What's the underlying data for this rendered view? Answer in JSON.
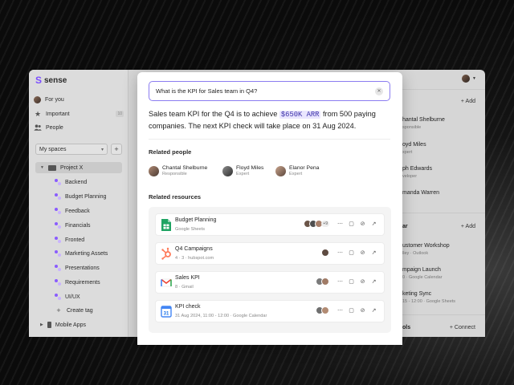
{
  "app": {
    "logo_text": "sense"
  },
  "sidebar": {
    "nav": [
      {
        "label": "For you",
        "icon": "avatar"
      },
      {
        "label": "Important",
        "icon": "star-icon",
        "count": "10"
      },
      {
        "label": "People",
        "icon": "people-icon"
      }
    ],
    "spaces_select": "My spaces",
    "project": "Project X",
    "tags": [
      "Backend",
      "Budget Planning",
      "Feedback",
      "Financials",
      "Fronted",
      "Marketing Assets",
      "Presentations",
      "Requirements",
      "UI/UX"
    ],
    "create_tag": "Create tag",
    "mobile_apps": "Mobile Apps"
  },
  "right_panel": {
    "add_label": "Add",
    "people": [
      {
        "name": "hantal Shelburne",
        "sub": "sponsible"
      },
      {
        "name": "oyd Miles",
        "sub": "xpert"
      },
      {
        "name": "ph Edwards",
        "sub": "veloper"
      },
      {
        "name": "manda Warren",
        "sub": ""
      }
    ],
    "section2_label": "ar",
    "events": [
      {
        "name": "ustomer Workshop",
        "sub": "lley · Outlook"
      },
      {
        "name": "mpaign Launch",
        "sub": "0 · Google Calendar"
      },
      {
        "name": "keting Sync",
        "sub": "15 - 12:00 · Google Sheets"
      }
    ],
    "section3_label": "ols",
    "connect_label": "Connect"
  },
  "search": {
    "query": "What is the KPI for Sales team in Q4?",
    "clear_icon": "close-icon"
  },
  "answer": {
    "part1": "Sales team KPI for the Q4 is to achieve ",
    "highlight": "$650K ARR",
    "part2": " from 500 paying companies. The next KPI check will take place on 31 Aug 2024."
  },
  "related_people": {
    "title": "Related people",
    "people": [
      {
        "name": "Chantal Shelburne",
        "role": "Responsible"
      },
      {
        "name": "Floyd Miles",
        "role": "Expert"
      },
      {
        "name": "Elanor Pena",
        "role": "Expert"
      }
    ]
  },
  "related_resources": {
    "title": "Related resources",
    "items": [
      {
        "title": "Budget Planning",
        "sub": "Google Sheets",
        "icon": "google-sheets-icon",
        "more": "+9"
      },
      {
        "title": "Q4 Campaigns",
        "sub": "4 · 3 · hubspot.com",
        "icon": "hubspot-icon"
      },
      {
        "title": "Sales KPI",
        "sub": "8 · Gmail",
        "icon": "gmail-icon"
      },
      {
        "title": "KPI check",
        "sub": "31 Aug 2024, 11:00 - 12:00 · Google Calendar",
        "icon": "google-calendar-icon",
        "cal_day": "31"
      }
    ]
  },
  "colors": {
    "accent": "#7b4dff",
    "highlight_bg": "#eae6ff",
    "highlight_fg": "#3a2fa8"
  }
}
